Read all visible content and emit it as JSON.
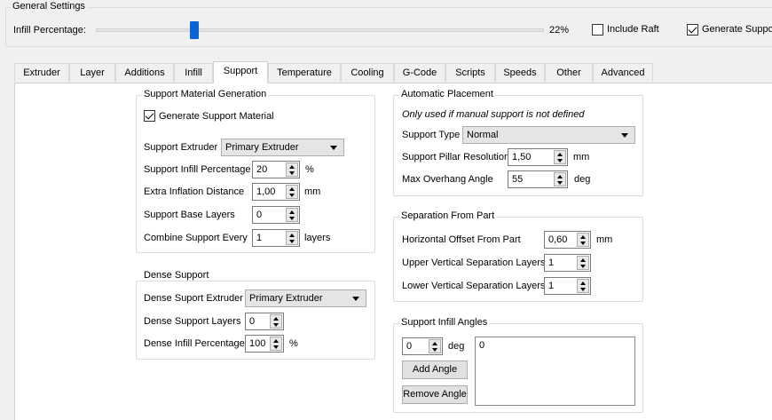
{
  "general": {
    "title": "General Settings",
    "infill_label": "Infill Percentage:",
    "infill_value_text": "22%",
    "infill_fraction": 0.22,
    "include_raft_label": "Include Raft",
    "include_raft_checked": false,
    "generate_support_label": "Generate Support",
    "generate_support_checked": true
  },
  "tabs": [
    "Extruder",
    "Layer",
    "Additions",
    "Infill",
    "Support",
    "Temperature",
    "Cooling",
    "G-Code",
    "Scripts",
    "Speeds",
    "Other",
    "Advanced"
  ],
  "active_tab": "Support",
  "support_material": {
    "title": "Support Material Generation",
    "generate_label": "Generate Support Material",
    "generate_checked": true,
    "extruder_label": "Support Extruder",
    "extruder_value": "Primary Extruder",
    "infill_pct_label": "Support Infill Percentage",
    "infill_pct_value": "20",
    "infill_pct_unit": "%",
    "inflation_label": "Extra Inflation Distance",
    "inflation_value": "1,00",
    "inflation_unit": "mm",
    "base_layers_label": "Support Base Layers",
    "base_layers_value": "0",
    "combine_label": "Combine Support Every",
    "combine_value": "1",
    "combine_unit": "layers"
  },
  "dense_support": {
    "title": "Dense Support",
    "extruder_label": "Dense Suport Extruder",
    "extruder_value": "Primary Extruder",
    "layers_label": "Dense Support Layers",
    "layers_value": "0",
    "infill_label": "Dense Infill Percentage",
    "infill_value": "100",
    "infill_unit": "%"
  },
  "automatic_placement": {
    "title": "Automatic Placement",
    "note": "Only used if manual support is not defined",
    "type_label": "Support Type",
    "type_value": "Normal",
    "pillar_label": "Support Pillar Resolution",
    "pillar_value": "1,50",
    "pillar_unit": "mm",
    "overhang_label": "Max Overhang Angle",
    "overhang_value": "55",
    "overhang_unit": "deg"
  },
  "separation": {
    "title": "Separation From Part",
    "horizontal_label": "Horizontal Offset From Part",
    "horizontal_value": "0,60",
    "horizontal_unit": "mm",
    "upper_label": "Upper Vertical Separation Layers",
    "upper_value": "1",
    "lower_label": "Lower Vertical Separation Layers",
    "lower_value": "1"
  },
  "infill_angles": {
    "title": "Support Infill Angles",
    "angle_value": "0",
    "angle_unit": "deg",
    "add_label": "Add Angle",
    "remove_label": "Remove Angle",
    "list_items": [
      "0"
    ]
  }
}
